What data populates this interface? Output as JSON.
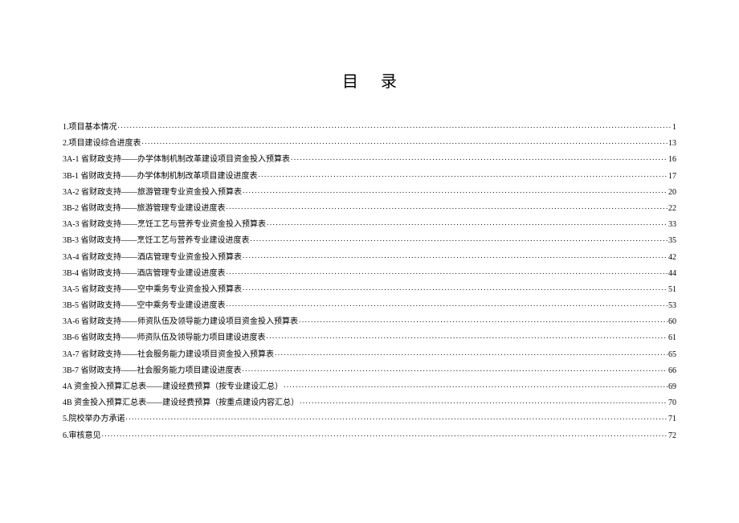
{
  "title": "目录",
  "toc": [
    {
      "label": "1.项目基本情况",
      "page": "1"
    },
    {
      "label": "2.项目建设综合进度表",
      "page": "13"
    },
    {
      "label": "3A-1 省财政支持——办学体制机制改革建设项目资金投入预算表",
      "page": "16"
    },
    {
      "label": "3B-1 省财政支持——办学体制机制改革项目建设进度表",
      "page": "17"
    },
    {
      "label": "3A-2 省财政支持——旅游管理专业资金投入预算表",
      "page": "20"
    },
    {
      "label": "3B-2 省财政支持——旅游管理专业建设进度表",
      "page": "22"
    },
    {
      "label": "3A-3 省财政支持——烹饪工艺与营养专业资金投入预算表",
      "page": "33"
    },
    {
      "label": "3B-3 省财政支持——烹饪工艺与营养专业建设进度表",
      "page": "35"
    },
    {
      "label": "3A-4 省财政支持——酒店管理专业资金投入预算表",
      "page": "42"
    },
    {
      "label": "3B-4 省财政支持——酒店管理专业建设进度表",
      "page": "44"
    },
    {
      "label": "3A-5 省财政支持——空中乘务专业资金投入预算表",
      "page": "51"
    },
    {
      "label": "3B-5 省财政支持——空中乘务专业建设进度表",
      "page": "53"
    },
    {
      "label": "3A-6 省财政支持——师资队伍及领导能力建设项目资金投入预算表",
      "page": "60"
    },
    {
      "label": "3B-6 省财政支持——师资队伍及领导能力项目建设进度表",
      "page": "61"
    },
    {
      "label": "3A-7 省财政支持——社会服务能力建设项目资金投入预算表",
      "page": "65"
    },
    {
      "label": "3B-7 省财政支持——社会服务能力项目建设进度表",
      "page": "66"
    },
    {
      "label": "4A 资金投入预算汇总表——建设经费预算（按专业建设汇总）",
      "page": "69"
    },
    {
      "label": "4B 资金投入预算汇总表——建设经费预算（按重点建设内容汇总）",
      "page": "70"
    },
    {
      "label": "5.院校举办方承诺",
      "page": "71"
    },
    {
      "label": "6.审核意见",
      "page": "72"
    }
  ]
}
